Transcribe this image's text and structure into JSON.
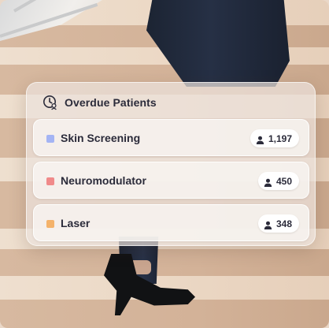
{
  "card": {
    "title": "Overdue Patients",
    "icon": "clock-patient-icon"
  },
  "rows": [
    {
      "label": "Skin Screening",
      "count": "1,197",
      "color": "#a4b4f4",
      "icon": "person-icon"
    },
    {
      "label": "Neuromodulator",
      "count": "450",
      "color": "#f08a8a",
      "icon": "person-icon"
    },
    {
      "label": "Laser",
      "count": "348",
      "color": "#f4b26a",
      "icon": "person-icon"
    }
  ]
}
